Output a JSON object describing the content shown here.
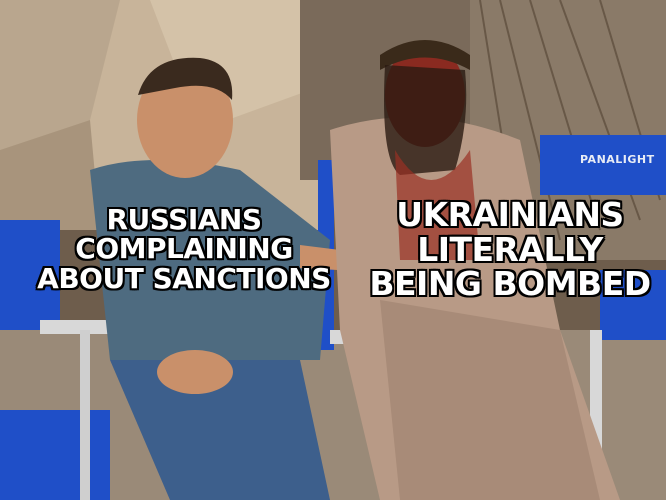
{
  "meme": {
    "left_caption": [
      "RUSSIANS",
      "COMPLAINING",
      "ABOUT SANCTIONS"
    ],
    "right_caption": [
      "UKRAINIANS",
      "LITERALLY",
      "BEING BOMBED"
    ],
    "chair_label": "PANALIGHT"
  },
  "colors": {
    "caption_fill": "#ffffff",
    "caption_outline": "#000000",
    "chair_blue": "#1f4fc8",
    "robe": "#b89a86",
    "denim": "#3d5f8c"
  }
}
